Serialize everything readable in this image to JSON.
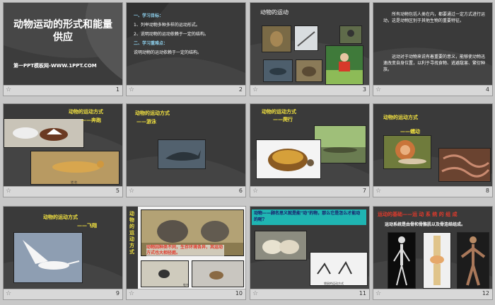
{
  "slides": [
    {
      "num": "1",
      "title": "动物运动的形式和能量供应",
      "subtitle": "第一PPT模板网-WWW.1PPT.COM"
    },
    {
      "num": "2",
      "sections": [
        {
          "heading": "一、学习目标：",
          "items": [
            "1、列举动物多种多样的运动形式。",
            "2、说明动物的运动依赖于一定的结构。"
          ]
        },
        {
          "heading": "二、学习重难点：",
          "items": [
            "说明动物的运动依赖于一定的结构。"
          ]
        }
      ]
    },
    {
      "num": "3",
      "title": "动物的运动"
    },
    {
      "num": "4",
      "para1": "所有动物包括人类在内，都要通过一定方式进行运动，这是动物区别于其他生物的重要特征。",
      "para2": "运动对于动物来说有着重要的意义，能够使动物迅速改变自身位置，以利于寻找食物、逃避敌害、繁衍种族。"
    },
    {
      "num": "5",
      "title": "动物的运动方式",
      "subtitle": "——奔跑",
      "caption": "猎 豹"
    },
    {
      "num": "6",
      "title": "动物的运动方式",
      "subtitle": "——游泳"
    },
    {
      "num": "7",
      "title": "动物的运动方式",
      "subtitle": "——爬行"
    },
    {
      "num": "8",
      "title": "动物的运动方式",
      "subtitle": "——蠕动"
    },
    {
      "num": "9",
      "title": "动物的运动方式",
      "subtitle": "——飞翔"
    },
    {
      "num": "10",
      "side_title": "动物的运动方式",
      "note": "动物因种类不同，生存环境各异，其运动方式也大相径庭。",
      "caption": "鸵鸟"
    },
    {
      "num": "11",
      "question": "动物——顾名思义就是能\"动\"的物，那么它是怎么才能动的呢？",
      "caption": "袋鼠的运动方式"
    },
    {
      "num": "12",
      "heading_red": "运动的基础",
      "heading_rest": "——运 动 系 统 的 组 成",
      "sub": "运动系统是由骨和骨骼肌以及骨连结组成。"
    }
  ],
  "footer_icon": "star-icon"
}
